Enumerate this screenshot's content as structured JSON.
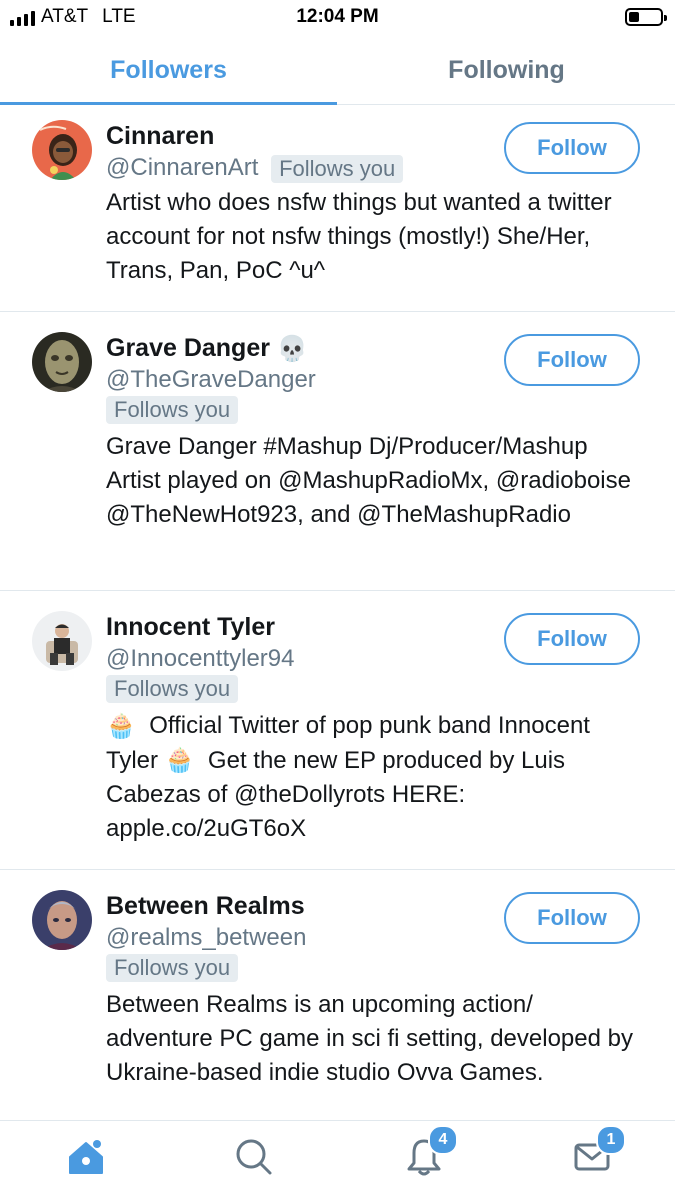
{
  "status_bar": {
    "carrier": "AT&T",
    "network": "LTE",
    "time": "12:04 PM"
  },
  "tabs": [
    {
      "label": "Followers",
      "active": true
    },
    {
      "label": "Following",
      "active": false
    }
  ],
  "users": [
    {
      "name": "Cinnaren",
      "name_emoji": "",
      "handle": "@CinnarenArt",
      "follows_you": "Follows you",
      "bio": "Artist who does nsfw things but wanted a twitter account for not nsfw things (mostly!) She/Her, Trans, Pan, PoC ^u^",
      "button": "Follow"
    },
    {
      "name": "Grave Danger",
      "name_emoji": "💀",
      "handle": "@TheGraveDanger",
      "follows_you": "Follows you",
      "bio": "Grave Danger #Mashup Dj/Producer/Mashup Artist played on @MashupRadioMx, @radioboise @TheNewHot923, and @TheMashupRadio",
      "button": "Follow"
    },
    {
      "name": "Innocent Tyler",
      "name_emoji": "",
      "handle": "@Innocenttyler94",
      "follows_you": "Follows you",
      "bio_part1": "Official Twitter of pop punk band Innocent Tyler",
      "bio_part2": "Get the new EP produced by Luis Cabezas of @theDollyrots HERE: apple.co/2uGT6oX",
      "bio_emoji": "🧁",
      "button": "Follow"
    },
    {
      "name": "Between Realms",
      "name_emoji": "",
      "handle": "@realms_between",
      "follows_you": "Follows you",
      "bio": "Between Realms is an upcoming action/ adventure PC game in sci fi setting, developed by Ukraine-based indie studio Ovva Games.",
      "button": "Follow"
    }
  ],
  "tab_bar": {
    "items": [
      {
        "icon": "home-icon"
      },
      {
        "icon": "search-icon"
      },
      {
        "icon": "notifications-bell-icon",
        "badge": "4"
      },
      {
        "icon": "messages-envelope-icon",
        "badge": "1"
      }
    ]
  },
  "colors": {
    "accent": "#4a9ae0",
    "secondary_text": "#657786",
    "badge_bg": "#e6ecf0",
    "divider": "#e1e8ed"
  }
}
